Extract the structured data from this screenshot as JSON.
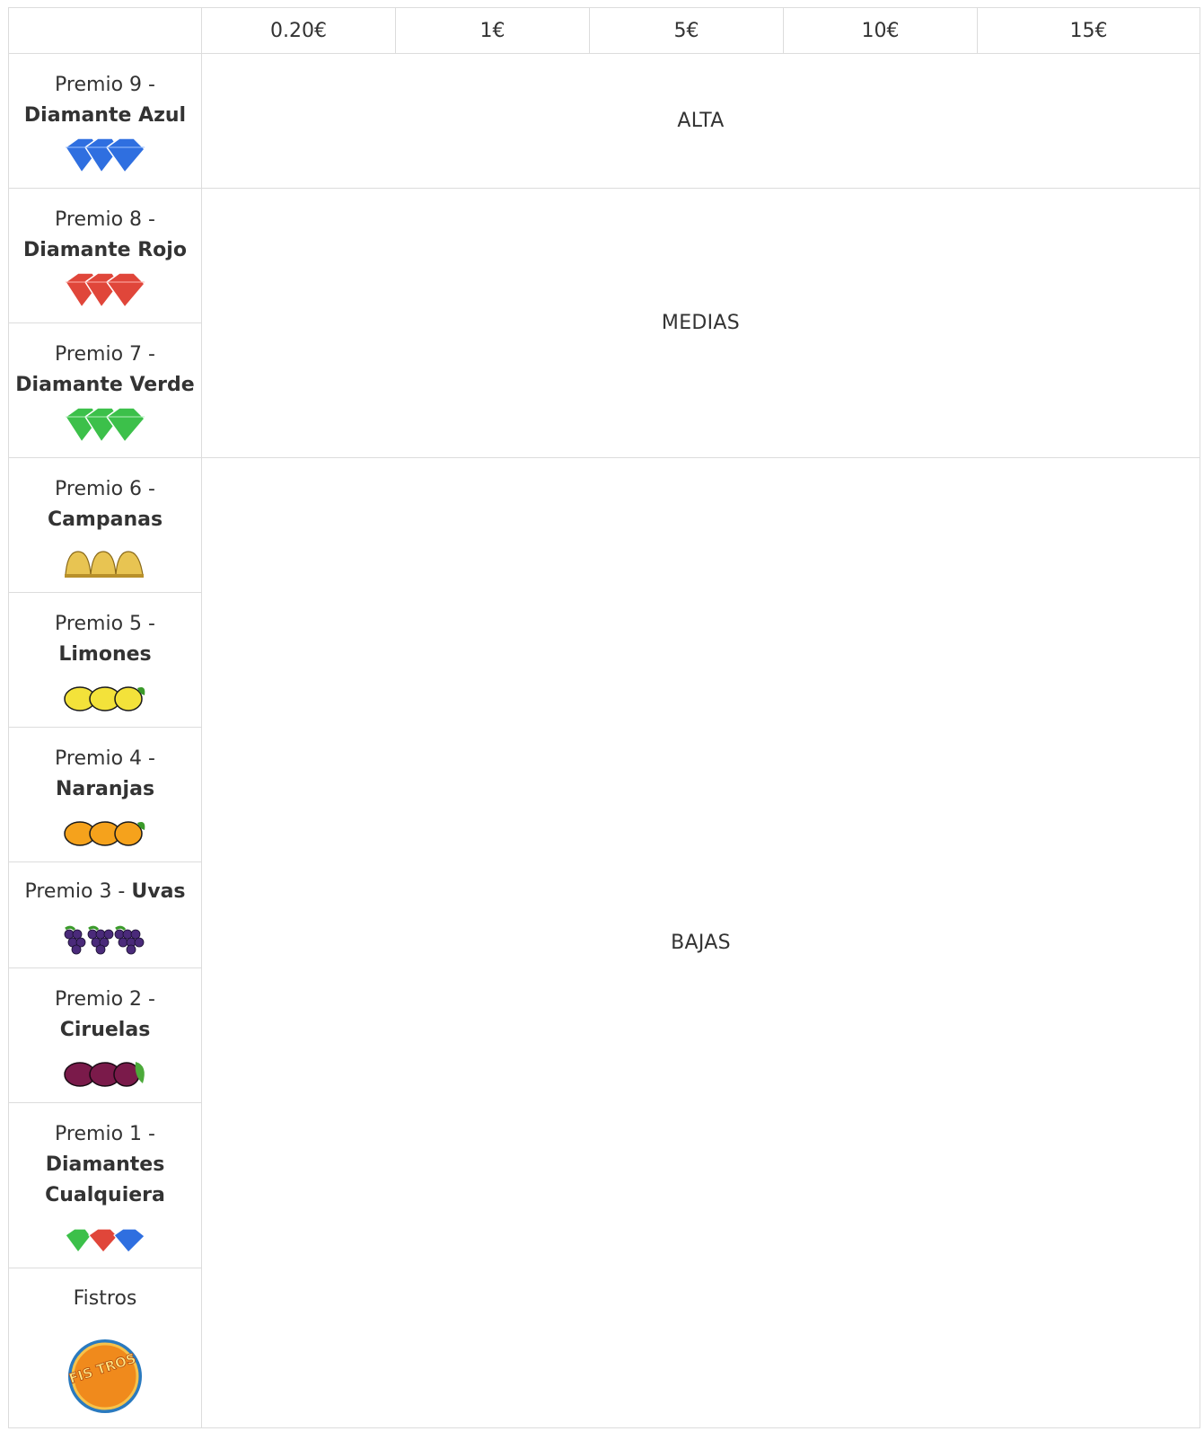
{
  "header": {
    "corner": "",
    "bets": [
      "0.20€",
      "1€",
      "5€",
      "10€",
      "15€"
    ]
  },
  "prizes": [
    {
      "prefix": "Premio 9 -",
      "name": "Diamante Azul",
      "icon": "blue-diamonds-icon"
    },
    {
      "prefix": "Premio 8 -",
      "name": "Diamante Rojo",
      "icon": "red-diamonds-icon"
    },
    {
      "prefix": "Premio 7 -",
      "name": "Diamante Verde",
      "icon": "green-diamonds-icon"
    },
    {
      "prefix": "Premio 6 -",
      "name": "Campanas",
      "icon": "bells-icon"
    },
    {
      "prefix": "Premio 5 -",
      "name": "Limones",
      "icon": "lemons-icon"
    },
    {
      "prefix": "Premio 4 -",
      "name": "Naranjas",
      "icon": "oranges-icon"
    },
    {
      "prefix": "Premio 3 -",
      "name": "Uvas",
      "icon": "grapes-icon"
    },
    {
      "prefix": "Premio 2 -",
      "name": "Ciruelas",
      "icon": "plums-icon"
    },
    {
      "prefix": "Premio 1 -",
      "name": "Diamantes Cualquiera",
      "icon": "mixed-diamonds-icon"
    },
    {
      "prefix": "",
      "name": "Fistros",
      "icon": "fistros-coin-icon"
    }
  ],
  "fistros_coin_text": "FIS TROS",
  "tiers": {
    "alta": "ALTA",
    "medias": "MEDIAS",
    "bajas": "BAJAS"
  },
  "colors": {
    "border": "#dcdcdc",
    "text": "#333333",
    "blue_diamond": "#2f6fe0",
    "red_diamond": "#e0463a",
    "green_diamond": "#3cc04a",
    "bell": "#e8c452",
    "lemon": "#f3e23a",
    "orange": "#f5a21c",
    "grape": "#4a2a7a",
    "plum": "#7a1a4a",
    "coin": "#f08a1c"
  }
}
